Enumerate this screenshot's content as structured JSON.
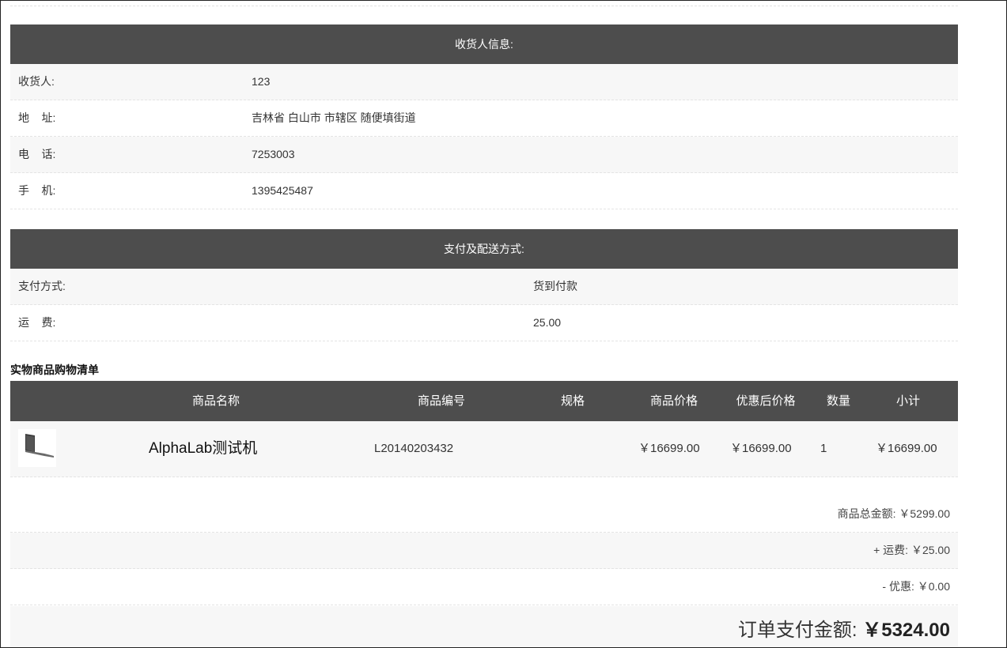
{
  "consignee_section": {
    "title": "收货人信息:",
    "rows": [
      {
        "label": "收货人:",
        "value": "123"
      },
      {
        "label": "地    址:",
        "value": "吉林省 白山市 市辖区 随便填街道"
      },
      {
        "label": "电    话:",
        "value": "7253003"
      },
      {
        "label": "手    机:",
        "value": "1395425487"
      }
    ]
  },
  "payment_section": {
    "title": "支付及配送方式:",
    "rows": [
      {
        "label": "支付方式:",
        "value": "货到付款"
      },
      {
        "label": "运    费:",
        "value": "25.00"
      }
    ]
  },
  "goods_section": {
    "title": "实物商品购物清单",
    "columns": [
      "商品名称",
      "商品编号",
      "规格",
      "商品价格",
      "优惠后价格",
      "数量",
      "小计"
    ],
    "items": [
      {
        "thumbnail": "laptop-image",
        "name": "AlphaLab测试机",
        "sku": "L20140203432",
        "spec": "",
        "price": "￥16699.00",
        "discount_price": "￥16699.00",
        "quantity": "1",
        "subtotal": "￥16699.00"
      }
    ]
  },
  "summary": {
    "goods_total_label": "商品总金额:",
    "goods_total": "￥5299.00",
    "shipping_label": "+ 运费:",
    "shipping": "￥25.00",
    "discount_label": "- 优惠:",
    "discount": "￥0.00",
    "order_total_label": "订单支付金额:",
    "order_total": "￥5324.00"
  },
  "colors": {
    "header_bg": "#4d4d4d",
    "row_shade": "#f7f7f7"
  }
}
